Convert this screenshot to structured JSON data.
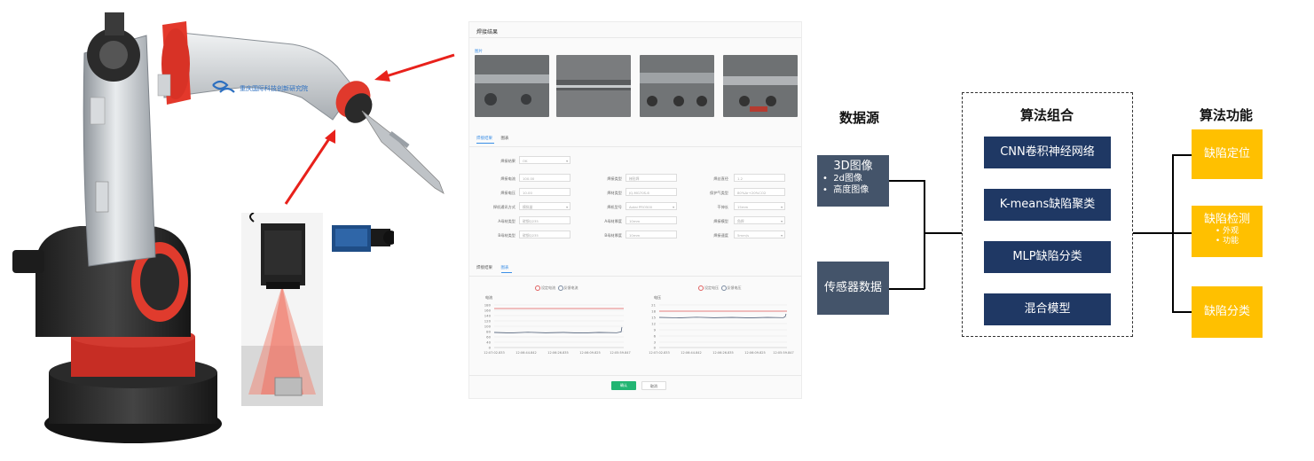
{
  "robot": {
    "logo_text": "重庆国际科技创新研究院"
  },
  "panel": {
    "title": "焊接结果",
    "images_label": "图片",
    "tabs_top": [
      "焊接结果",
      "图表"
    ],
    "form": [
      {
        "label": "焊接结果",
        "value": "OK",
        "type": "select"
      },
      {
        "label": "焊接电流",
        "value": "100.00"
      },
      {
        "label": "焊接类型",
        "value": "梯形焊"
      },
      {
        "label": "焊丝直径",
        "value": "1.2"
      },
      {
        "label": "焊接电压",
        "value": "10.00"
      },
      {
        "label": "焊材类型",
        "value": "JQ-MG70S-6"
      },
      {
        "label": "保护气类型",
        "value": "80%Ar+20%CO2"
      },
      {
        "label": "焊机通讯方式",
        "value": "模拟量",
        "type": "select"
      },
      {
        "label": "焊机型号",
        "value": "Aotai PRO500",
        "type": "select"
      },
      {
        "label": "干伸长",
        "value": "15mm",
        "type": "select"
      },
      {
        "label": "A母材类型",
        "value": "碳钢Q235"
      },
      {
        "label": "A母材厚度",
        "value": "10mm"
      },
      {
        "label": "焊接模型",
        "value": "角焊",
        "type": "select"
      },
      {
        "label": "B母材类型",
        "value": "碳钢Q235"
      },
      {
        "label": "B母材厚度",
        "value": "10mm"
      },
      {
        "label": "焊接速度",
        "value": "5mm/s",
        "type": "select"
      }
    ],
    "tabs_bottom": [
      "焊接结果",
      "图表"
    ],
    "chart_left": {
      "legend": [
        "设定电流",
        "反馈电流"
      ],
      "ylabel": "电流",
      "yticks": [
        "180",
        "160",
        "140",
        "120",
        "100",
        "80",
        "60",
        "40",
        "20",
        "0"
      ],
      "xticks": [
        "12:07:02.833",
        "12:06:44.842",
        "12:06:26.835",
        "12:06:09.825",
        "12:05:59.847"
      ]
    },
    "chart_right": {
      "legend": [
        "设定电压",
        "反馈电压"
      ],
      "ylabel": "电压",
      "yticks": [
        "21",
        "18",
        "15",
        "12",
        "9",
        "6",
        "3",
        "0"
      ],
      "xticks": [
        "12:07:02.833",
        "12:06:44.842",
        "12:06:26.835",
        "12:06:09.825",
        "12:05:59.847"
      ]
    },
    "ok_label": "确认",
    "cancel_label": "取消"
  },
  "diagram": {
    "headers": {
      "source": "数据源",
      "algo": "算法组合",
      "func": "算法功能"
    },
    "source_3d": {
      "title": "3D图像",
      "items": [
        "2d图像",
        "高度图像"
      ]
    },
    "source_sensor": "传感器数据",
    "algos": [
      "CNN卷积神经网络",
      "K-means缺陷聚类",
      "MLP缺陷分类",
      "混合模型"
    ],
    "func_locate": "缺陷定位",
    "func_detect": {
      "title": "缺陷检测",
      "items": [
        "外观",
        "功能"
      ]
    },
    "func_classify": "缺陷分类"
  },
  "colors": {
    "source_box": "#44546a",
    "algo_box": "#1f3864",
    "func_box": "#ffc000",
    "arrow": "#e8211b",
    "ok_button": "#22b573"
  }
}
